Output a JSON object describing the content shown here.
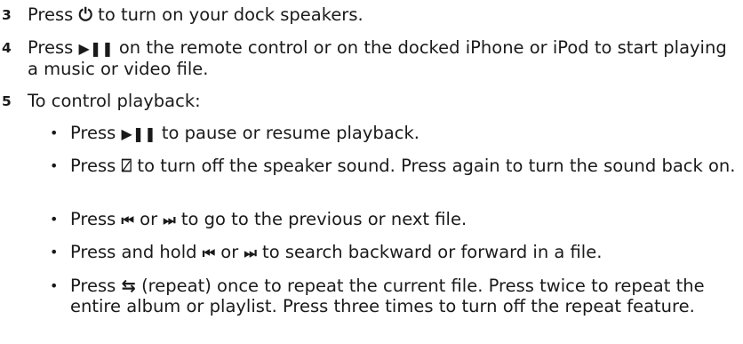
{
  "step3": {
    "number": "3",
    "before": "Press ",
    "icon": "⏻",
    "icon_name": "power-icon",
    "after": " to turn on your dock speakers."
  },
  "step4": {
    "number": "4",
    "before": "Press ",
    "icon": "▶❚❚",
    "icon_name": "play-pause-icon",
    "after": " on the remote control or on the docked iPhone or iPod to start playing a music or video file."
  },
  "step5": {
    "number": "5",
    "text": "To control playback:"
  },
  "bullets": {
    "b1": {
      "before": "Press ",
      "icon": "▶❚❚",
      "icon_name": "play-pause-icon",
      "after": " to pause or resume playback."
    },
    "b2": {
      "before": "Press ",
      "icon": "⍁",
      "icon_name": "mute-icon",
      "after": " to turn off the speaker sound. Press again to turn the sound back on."
    },
    "b3": {
      "before": "Press ",
      "icon1": "⏮",
      "icon1_name": "previous-icon",
      "mid": " or ",
      "icon2": "⏭",
      "icon2_name": "next-icon",
      "after": " to go to the previous or next file."
    },
    "b4": {
      "before": "Press and hold ",
      "icon1": "⏮",
      "icon1_name": "previous-icon",
      "mid": " or ",
      "icon2": "⏭",
      "icon2_name": "next-icon",
      "after": " to search backward or forward in a file."
    },
    "b5": {
      "before": "Press ",
      "icon": "⇆",
      "icon_name": "repeat-icon",
      "after": " (repeat) once to repeat the current file. Press twice to repeat the entire album or playlist. Press three times to turn off the repeat feature."
    },
    "bullet_char": "•"
  }
}
